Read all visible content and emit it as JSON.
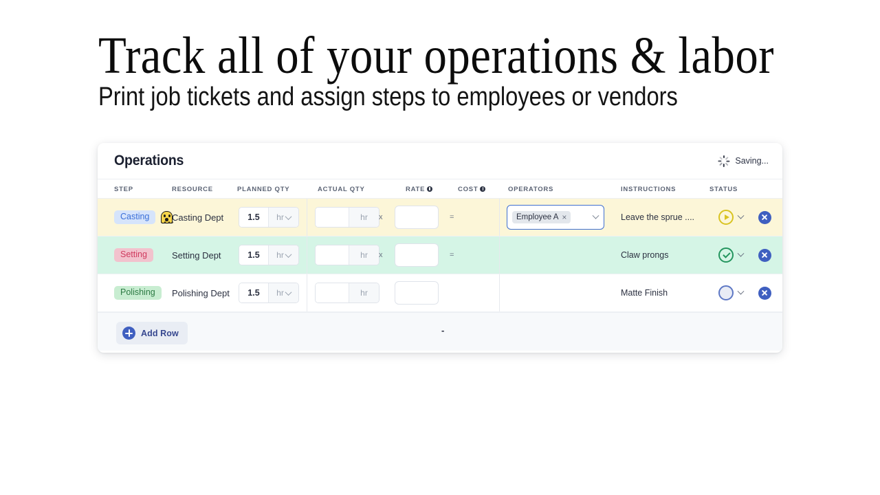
{
  "hero": {
    "title": "Track all of your operations & labor",
    "subtitle": "Print job tickets and assign steps to employees or vendors"
  },
  "card": {
    "title": "Operations",
    "saving_status": "Saving...",
    "spinner_icon": "spinner-icon",
    "columns": [
      {
        "label": "STEP",
        "info": false
      },
      {
        "label": "RESOURCE",
        "info": false
      },
      {
        "label": "PLANNED QTY",
        "info": false
      },
      {
        "label": "ACTUAL QTY",
        "info": false
      },
      {
        "label": "RATE",
        "info": true
      },
      {
        "label": "COST",
        "info": true
      },
      {
        "label": "OPERATORS",
        "info": false
      },
      {
        "label": "INSTRUCTIONS",
        "info": false
      },
      {
        "label": "STATUS",
        "info": false
      }
    ],
    "rows": [
      {
        "step": "Casting",
        "step_style": "casting",
        "has_ghost_icon": true,
        "ghost_icon": "ghost-icon",
        "resource": "Casting Dept",
        "planned_qty": "1.5",
        "planned_unit": "hr",
        "actual_qty": "",
        "actual_unit": "hr",
        "multiply_symbol": "x",
        "rate": "",
        "equals_symbol": "=",
        "operators": [
          {
            "name": "Employee A",
            "remove": "×"
          }
        ],
        "instructions": "Leave the sprue ....",
        "status": "in-progress",
        "delete_label": "×"
      },
      {
        "step": "Setting",
        "step_style": "setting",
        "has_ghost_icon": false,
        "resource": "Setting Dept",
        "planned_qty": "1.5",
        "planned_unit": "hr",
        "actual_qty": "",
        "actual_unit": "hr",
        "multiply_symbol": "x",
        "rate": "",
        "equals_symbol": "=",
        "operators": [],
        "instructions": "Claw prongs",
        "status": "complete",
        "delete_label": "×"
      },
      {
        "step": "Polishing",
        "step_style": "polishing",
        "has_ghost_icon": false,
        "resource": "Polishing Dept",
        "planned_qty": "1.5",
        "planned_unit": "hr",
        "actual_qty": "",
        "actual_unit": "hr",
        "multiply_symbol": "",
        "rate": "",
        "equals_symbol": "",
        "operators": [],
        "instructions": "Matte Finish",
        "status": "not-started",
        "delete_label": "×"
      }
    ],
    "footer": {
      "add_row_label": "Add Row",
      "add_icon": "plus-circle-icon",
      "dash": "-"
    }
  },
  "colors": {
    "accent_blue": "#3f5fc0",
    "row_yellow": "#fcf6d8",
    "row_green": "#d5f5e6",
    "status_in_progress": "#d9c321",
    "status_complete": "#23955e",
    "status_not_started": "#5d77c4"
  }
}
